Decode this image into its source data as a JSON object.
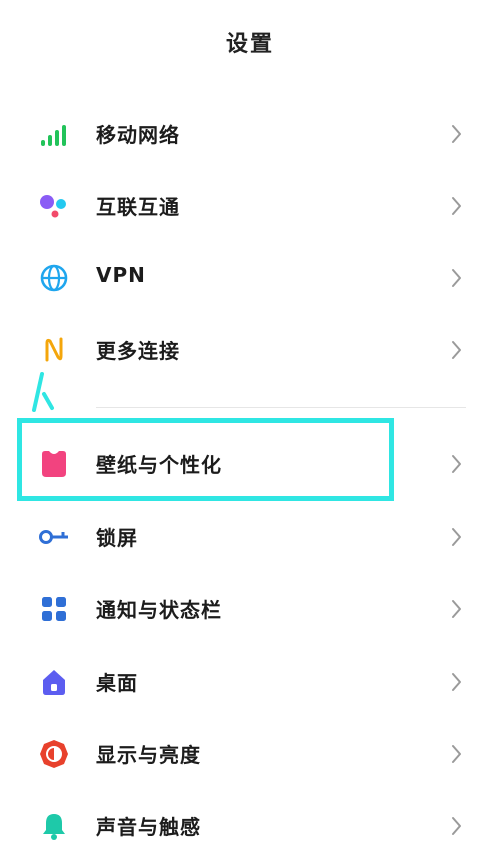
{
  "header": {
    "title": "设置"
  },
  "settings_items": [
    {
      "label": "移动网络",
      "icon": "signal-bars-icon"
    },
    {
      "label": "互联互通",
      "icon": "dots-connect-icon"
    },
    {
      "label": "VPN",
      "icon": "globe-icon"
    },
    {
      "label": "更多连接",
      "icon": "nfc-icon"
    },
    {
      "label": "壁纸与个性化",
      "icon": "tshirt-icon"
    },
    {
      "label": "锁屏",
      "icon": "key-icon"
    },
    {
      "label": "通知与状态栏",
      "icon": "grid-icon"
    },
    {
      "label": "桌面",
      "icon": "home-icon"
    },
    {
      "label": "显示与亮度",
      "icon": "brightness-icon"
    },
    {
      "label": "声音与触感",
      "icon": "bell-icon"
    }
  ],
  "annotation": {
    "highlight_color": "#2fe6e3"
  },
  "colors": {
    "signal": "#22c35a",
    "globe": "#1fa6ee",
    "nfc": "#f4a60b",
    "wallpaper": "#f2437f",
    "lock": "#2f6fd6",
    "notify": "#2f6fd6",
    "home": "#5c5df0",
    "display": "#e8412c",
    "bell": "#1ec9a9"
  }
}
